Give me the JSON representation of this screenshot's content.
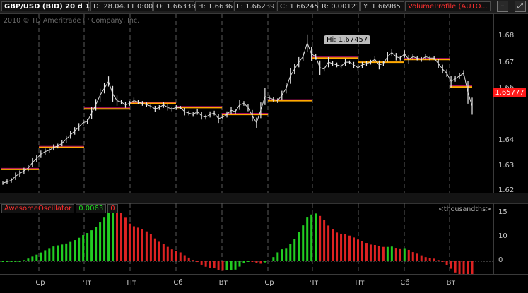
{
  "header": {
    "symbol": "GBP/USD (BID) 20 d 1h",
    "date": "D: 28.04.11 0:00",
    "open": "O: 1.66338",
    "high": "H: 1.6636",
    "low": "L: 1.66239",
    "close": "C: 1.66245",
    "range": "R: 0.00121",
    "y": "Y: 1.66985",
    "study": "VolumeProfile (AUTO..."
  },
  "copyright": "2010 © TD Ameritrade IP Company, Inc.",
  "price_axis": {
    "labels": [
      "1.68",
      "1.67",
      "1.66",
      "1.64",
      "1.63",
      "1.62"
    ],
    "last_price": "1.65777"
  },
  "hi_label": "Hi: 1.67457",
  "oscillator": {
    "name": "AwesomeOscillator",
    "value": "0.0063",
    "zero": "0",
    "units": "<thousandths>",
    "axis_labels": [
      "15",
      "10",
      "0"
    ]
  },
  "x_axis": {
    "labels": [
      "Ср",
      "Чт",
      "Пт",
      "Сб",
      "Вт",
      "Ср",
      "Чт",
      "Пт",
      "Сб",
      "Вт"
    ]
  },
  "colors": {
    "up": "#22cc22",
    "down": "#dd2222",
    "profile_line": "#ffaa00",
    "last_price": "#ff1a1a"
  },
  "chart_data": {
    "type": "line",
    "title": "GBP/USD (BID) 20 d 1h",
    "ylim": [
      1.62,
      1.685
    ],
    "series": [
      {
        "values": [
          1.6235,
          1.624,
          1.6245,
          1.626,
          1.627,
          1.628,
          1.629,
          1.631,
          1.6325,
          1.634,
          1.635,
          1.6355,
          1.6365,
          1.637,
          1.638,
          1.6395,
          1.641,
          1.6425,
          1.644,
          1.6455,
          1.646,
          1.649,
          1.652,
          1.6555,
          1.658,
          1.6605,
          1.656,
          1.6535,
          1.653,
          1.652,
          1.6525,
          1.6535,
          1.653,
          1.6525,
          1.652,
          1.6515,
          1.6505,
          1.651,
          1.652,
          1.651,
          1.6505,
          1.651,
          1.651,
          1.6495,
          1.649,
          1.6485,
          1.6495,
          1.648,
          1.6475,
          1.6485,
          1.649,
          1.647,
          1.6475,
          1.6485,
          1.65,
          1.6495,
          1.652,
          1.6525,
          1.651,
          1.648,
          1.6455,
          1.65,
          1.655,
          1.6545,
          1.654,
          1.6535,
          1.6555,
          1.658,
          1.6625,
          1.665,
          1.6675,
          1.6695,
          1.6745,
          1.6705,
          1.6695,
          1.6655,
          1.665,
          1.6675,
          1.667,
          1.6665,
          1.666,
          1.6675,
          1.6675,
          1.6665,
          1.6655,
          1.6665,
          1.667,
          1.6675,
          1.6685,
          1.6665,
          1.667,
          1.6695,
          1.671,
          1.6695,
          1.669,
          1.6705,
          1.6685,
          1.6695,
          1.669,
          1.6685,
          1.6695,
          1.669,
          1.669,
          1.667,
          1.665,
          1.6635,
          1.6605,
          1.6615,
          1.6625,
          1.6635,
          1.6565,
          1.6515
        ]
      }
    ]
  }
}
